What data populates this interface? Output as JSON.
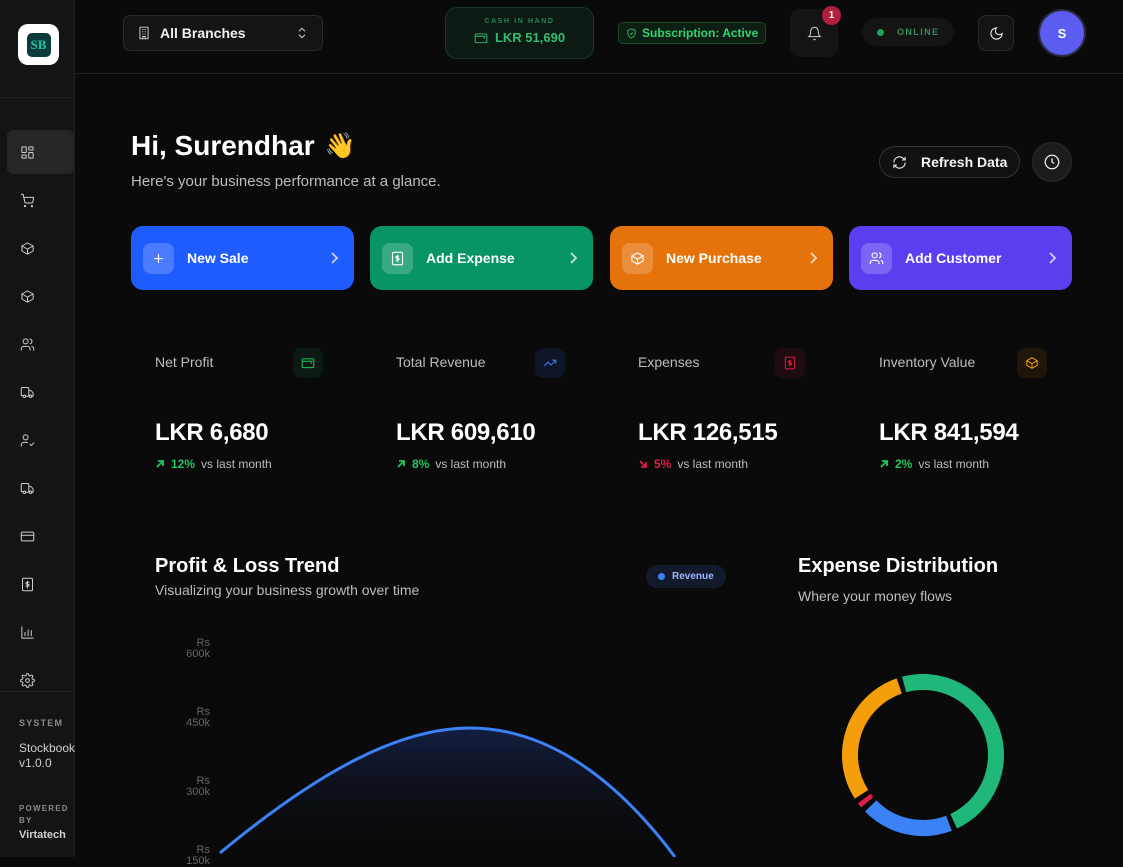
{
  "app": {
    "logo_text": "SB"
  },
  "sidebar": {
    "items": [
      {
        "name": "dashboard",
        "icon": "grid-icon",
        "active": true
      },
      {
        "name": "sales",
        "icon": "cart-icon"
      },
      {
        "name": "products",
        "icon": "box-icon"
      },
      {
        "name": "inventory",
        "icon": "package-icon"
      },
      {
        "name": "customers",
        "icon": "users-icon"
      },
      {
        "name": "deliveries",
        "icon": "truck-icon"
      },
      {
        "name": "suppliers",
        "icon": "user-check-icon"
      },
      {
        "name": "purchases",
        "icon": "truck-icon"
      },
      {
        "name": "payments",
        "icon": "credit-card-icon"
      },
      {
        "name": "expenses",
        "icon": "dollar-icon"
      },
      {
        "name": "reports",
        "icon": "bar-chart-icon"
      },
      {
        "name": "settings",
        "icon": "gear-icon"
      }
    ],
    "system_label": "SYSTEM",
    "system_name": "Stockbook",
    "system_version": "v1.0.0",
    "powered_label": "POWERED BY",
    "powered_by": "Virtatech"
  },
  "topbar": {
    "branch": "All Branches",
    "cash_label": "CASH IN HAND",
    "cash_value": "LKR 51,690",
    "subscription": "Subscription: Active",
    "notification_count": "1",
    "status": "ONLINE",
    "avatar_initial": "S"
  },
  "greeting": {
    "title": "Hi, Surendhar",
    "emoji": "👋",
    "subtitle": "Here's your business performance at a glance.",
    "refresh_label": "Refresh Data"
  },
  "quick_actions": [
    {
      "label": "New Sale",
      "color": "#1f5cff",
      "icon": "plus-icon"
    },
    {
      "label": "Add Expense",
      "color": "#079467",
      "icon": "dollar-icon"
    },
    {
      "label": "New Purchase",
      "color": "#e5720a",
      "icon": "box-icon"
    },
    {
      "label": "Add Customer",
      "color": "#5a3ff0",
      "icon": "users-icon"
    }
  ],
  "stats": [
    {
      "title": "Net Profit",
      "value": "LKR 6,680",
      "pct": "12%",
      "direction": "up",
      "suffix": "vs last month",
      "accent": "#22c55e"
    },
    {
      "title": "Total Revenue",
      "value": "LKR 609,610",
      "pct": "8%",
      "direction": "up",
      "suffix": "vs last month",
      "accent": "#3b82f6"
    },
    {
      "title": "Expenses",
      "value": "LKR 126,515",
      "pct": "5%",
      "direction": "down",
      "suffix": "vs last month",
      "accent": "#e11d48"
    },
    {
      "title": "Inventory Value",
      "value": "LKR 841,594",
      "pct": "2%",
      "direction": "up",
      "suffix": "vs last month",
      "accent": "#f59e0b"
    }
  ],
  "trend_chart": {
    "title": "Profit & Loss Trend",
    "subtitle": "Visualizing your business growth over time",
    "legend": "Revenue"
  },
  "expense_chart": {
    "title": "Expense Distribution",
    "subtitle": "Where your money flows"
  },
  "chart_data": [
    {
      "type": "area",
      "series": [
        {
          "name": "Revenue",
          "color": "#3b82f6"
        }
      ],
      "ytick_labels": [
        "Rs 600k",
        "Rs 450k",
        "Rs 300k",
        "Rs 150k"
      ],
      "note": "curve shape only partially visible"
    },
    {
      "type": "pie",
      "slices": [
        {
          "value": 46,
          "color": "#1fb87a"
        },
        {
          "value": 18,
          "color": "#3b82f6"
        },
        {
          "value": 1,
          "color": "#e11d48"
        },
        {
          "value": 28,
          "color": "#f59e0b"
        }
      ]
    }
  ]
}
